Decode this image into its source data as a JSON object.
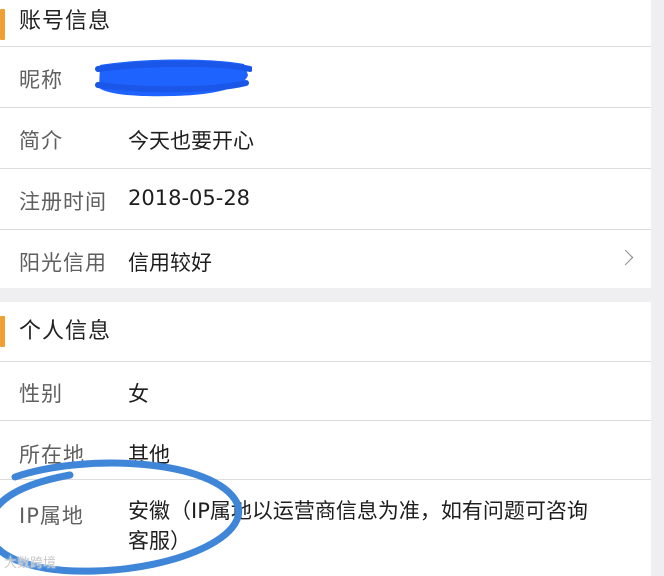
{
  "account_section": {
    "title": "账号信息",
    "rows": [
      {
        "label": "昵称",
        "value": ""
      },
      {
        "label": "简介",
        "value": "今天也要开心"
      },
      {
        "label": "注册时间",
        "value": "2018-05-28"
      },
      {
        "label": "阳光信用",
        "value": "信用较好"
      }
    ]
  },
  "personal_section": {
    "title": "个人信息",
    "rows": [
      {
        "label": "性别",
        "value": "女"
      },
      {
        "label": "所在地",
        "value": "其他"
      },
      {
        "label": "IP属地",
        "value": "安徽（IP属地以运营商信息为准，如有问题可咨询客服）"
      }
    ]
  },
  "watermark": "大数跨境",
  "colors": {
    "accent_bar": "#f0a030",
    "scribble": "#1f63ff",
    "annotation_circle": "#3f86d8",
    "section_gap": "#efeff1"
  },
  "icons": {
    "credit_row": "chevron-right-icon"
  }
}
